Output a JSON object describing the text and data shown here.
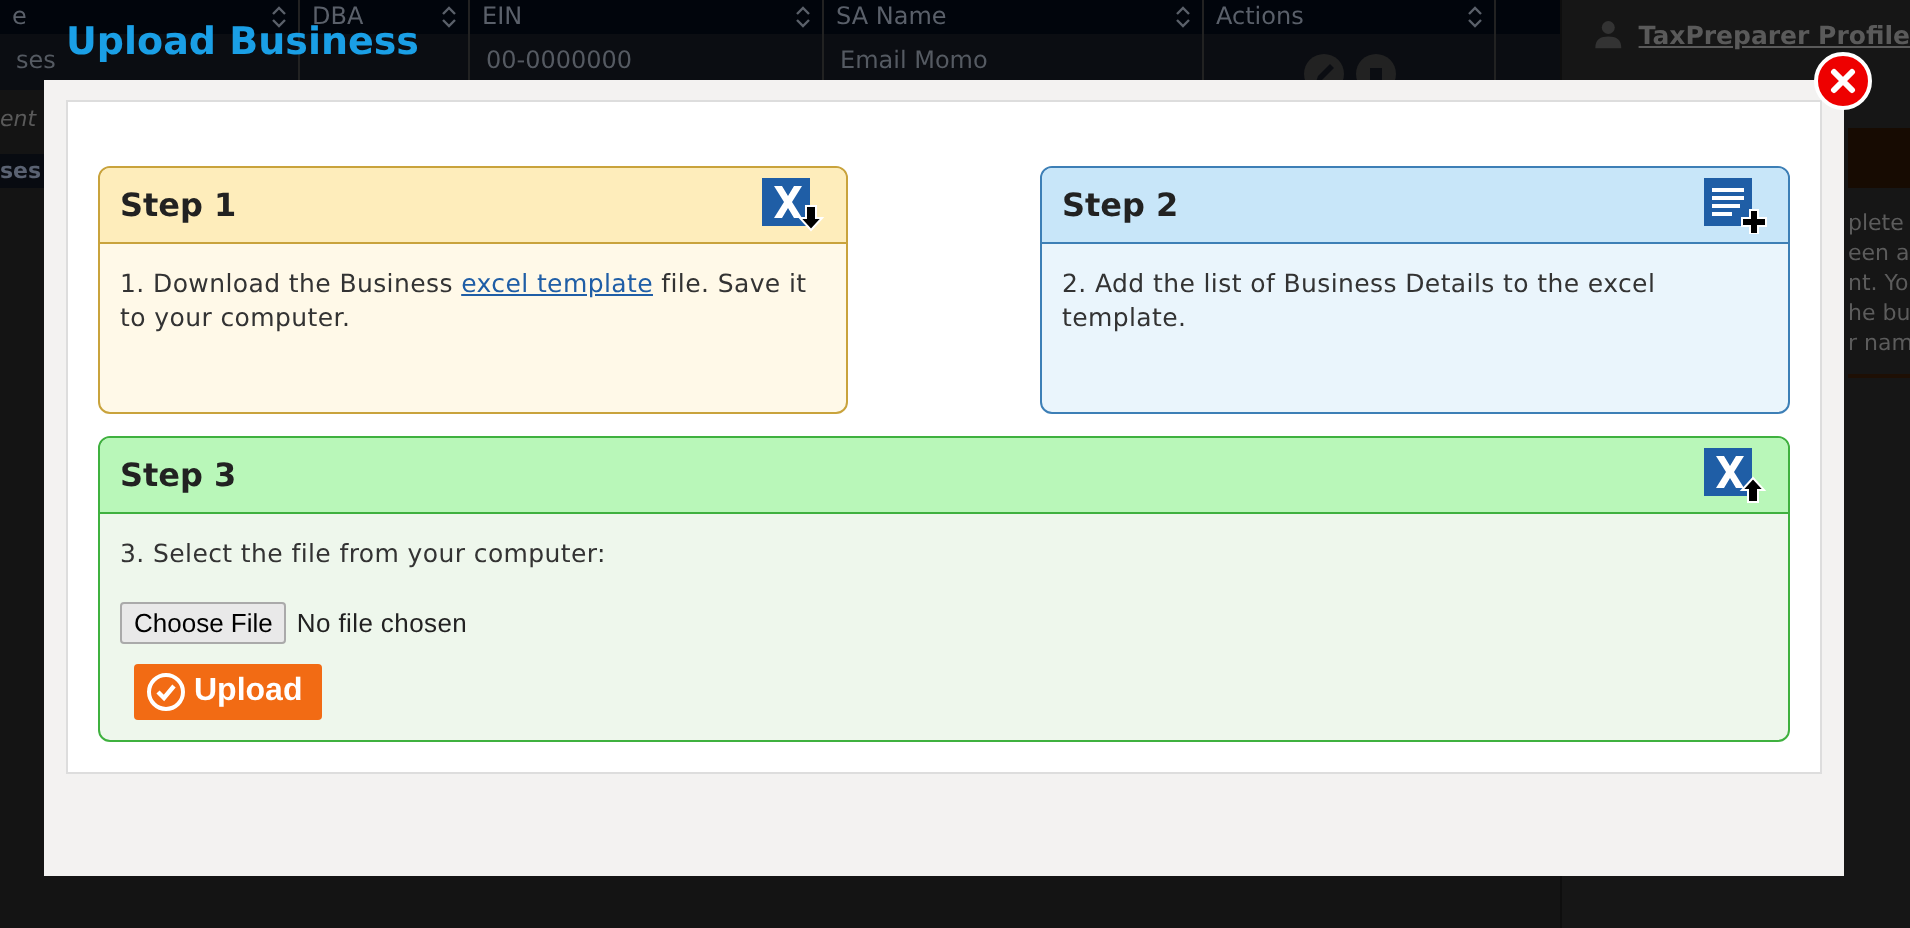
{
  "background": {
    "table": {
      "columns": [
        {
          "label": "e",
          "sortable": true
        },
        {
          "label": "DBA",
          "sortable": true
        },
        {
          "label": "EIN",
          "sortable": true
        },
        {
          "label": "SA Name",
          "sortable": true
        },
        {
          "label": "Actions",
          "sortable": true
        }
      ],
      "row": {
        "column_1": "ses",
        "ein": "00-0000000",
        "sa_name": "Email Momo"
      }
    },
    "left_texts": [
      "ent",
      "ses"
    ],
    "profile_link": "TaxPreparer Profile",
    "side_lines": [
      "plete",
      "een a",
      "nt. Yo",
      "he bu",
      "r nam"
    ]
  },
  "modal": {
    "title": "Upload Business",
    "steps": [
      {
        "kind": "download",
        "title": "Step 1",
        "text_before": "1. Download the Business ",
        "link": "excel template",
        "text_after": " file. Save it to your computer."
      },
      {
        "kind": "add",
        "title": "Step 2",
        "text_before": "2. Add the list of Business Details to the excel template."
      },
      {
        "kind": "upload",
        "title": "Step 3",
        "text_before": "3. Select the file from your computer:",
        "file_button": "Choose File",
        "file_status": "No file chosen",
        "upload_button": "Upload"
      }
    ]
  }
}
